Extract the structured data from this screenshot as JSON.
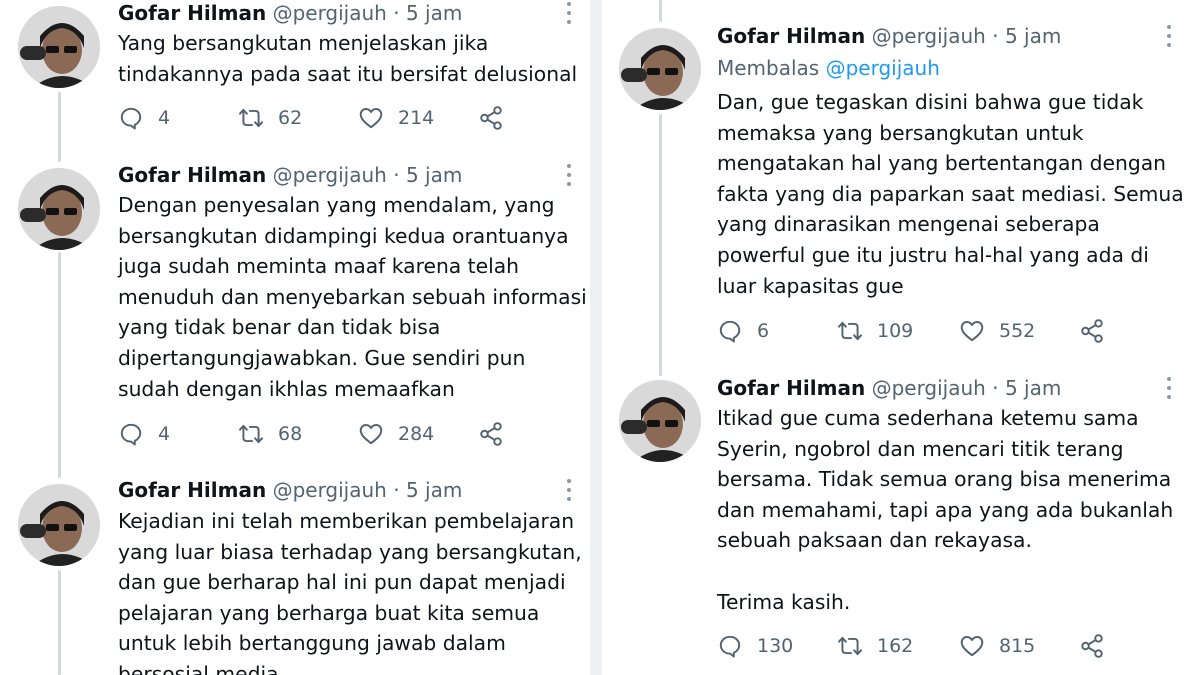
{
  "author": {
    "name": "Gofar Hilman",
    "handle": "@pergijauh",
    "separator": "·",
    "avatar_description": "avatar-photo"
  },
  "icons": {
    "reply": "reply-icon",
    "retweet": "retweet-icon",
    "like": "like-icon",
    "share": "share-icon",
    "more": "more-options-icon"
  },
  "colors": {
    "text": "#0f1419",
    "muted": "#536471",
    "link": "#1d9bf0",
    "thread_line": "#cfd9de",
    "divider": "#eef1f3"
  },
  "left_tweets": [
    {
      "time": "5 jam",
      "lines": [
        "Yang bersangkutan menjelaskan jika",
        "tindakannya pada saat itu bersifat delusional"
      ],
      "replies": "4",
      "retweets": "62",
      "likes": "214"
    },
    {
      "time": "5 jam",
      "lines": [
        "Dengan penyesalan yang mendalam, yang",
        "bersangkutan didampingi kedua orantuanya",
        "juga sudah meminta maaf karena telah",
        "menuduh dan menyebarkan sebuah informasi",
        "yang tidak benar dan tidak bisa",
        "dipertangungjawabkan. Gue sendiri pun",
        "sudah dengan ikhlas memaafkan"
      ],
      "replies": "4",
      "retweets": "68",
      "likes": "284"
    },
    {
      "time": "5 jam",
      "lines": [
        "Kejadian ini telah memberikan pembelajaran",
        "yang luar biasa terhadap yang bersangkutan,",
        "dan gue berharap hal ini pun dapat menjadi",
        "pelajaran yang berharga buat kita semua",
        "untuk lebih bertanggung jawab dalam",
        "bersosial media"
      ]
    }
  ],
  "right_tweets": [
    {
      "time": "5 jam",
      "reply_prefix": "Membalas",
      "reply_mention": "@pergijauh",
      "lines": [
        "Dan, gue tegaskan disini bahwa gue tidak",
        "memaksa yang bersangkutan untuk",
        "mengatakan hal yang bertentangan dengan",
        "fakta yang dia paparkan saat mediasi. Semua",
        "yang dinarasikan mengenai seberapa",
        "powerful gue itu justru hal-hal yang ada di",
        "luar kapasitas gue"
      ],
      "replies": "6",
      "retweets": "109",
      "likes": "552"
    },
    {
      "time": "5 jam",
      "lines": [
        "Itikad gue cuma sederhana ketemu sama",
        "Syerin, ngobrol dan mencari titik terang",
        "bersama. Tidak semua orang bisa menerima",
        "dan memahami, tapi apa yang ada bukanlah",
        "sebuah paksaan dan rekayasa.",
        "",
        "Terima kasih."
      ],
      "replies": "130",
      "retweets": "162",
      "likes": "815"
    }
  ]
}
